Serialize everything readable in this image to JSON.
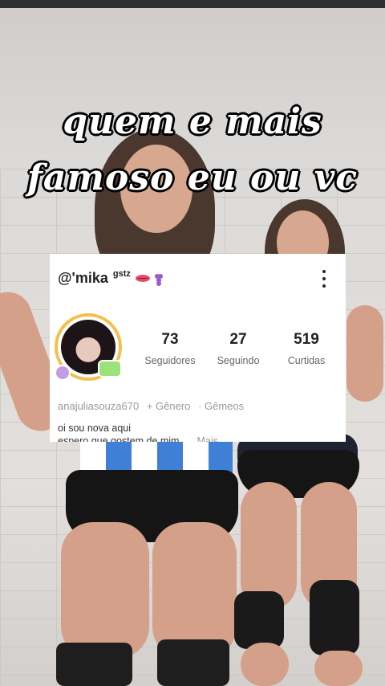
{
  "caption": {
    "line1": "quem e mais",
    "line2": "famoso eu ou vc"
  },
  "profile": {
    "handle": "@'mika",
    "handle_suffix": "gstz",
    "stats": [
      {
        "value": "73",
        "label": "Seguidores"
      },
      {
        "value": "27",
        "label": "Seguindo"
      },
      {
        "value": "519",
        "label": "Curtidas"
      }
    ],
    "meta": {
      "account": "anajuliasouza670",
      "gender": "+ Gênero",
      "sign": "· Gêmeos"
    },
    "bio_line1": "oi sou nova aqui",
    "bio_line2": "espero que gostem de mim",
    "bio_more": "Mais"
  },
  "icons": [
    "lips-icon",
    "grape-icon",
    "more-options-icon"
  ],
  "colors": {
    "card_bg": "#ffffff",
    "caption_text": "#ffffff",
    "caption_outline": "#000000"
  }
}
